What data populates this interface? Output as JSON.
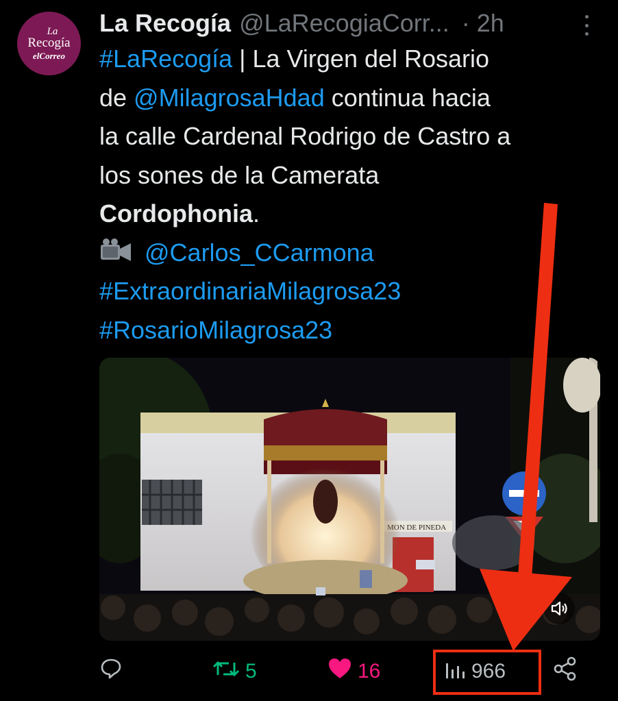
{
  "tweet": {
    "author_name": "La Recogía",
    "handle": "@LaRecogiaCorr...",
    "separator": "·",
    "time": "2h",
    "avatar": {
      "line1": "La",
      "line2": "Recogía",
      "line3": "elCorreo",
      "bg": "#7d1a55"
    },
    "text": {
      "l1_tag": "#LaRecogía",
      "l1_rest": " | La Virgen del Rosario",
      "l2_pre": "de ",
      "l2_mention": "@MilagrosaHdad",
      "l2_rest": " continua hacia",
      "l3": "la calle Cardenal Rodrigo de Castro a",
      "l4": "los sones de la Camerata",
      "l5_bold": "Cordophonia",
      "l5_rest": ".",
      "l6_mention": "@Carlos_CCarmona",
      "l7_tag": "#ExtraordinariaMilagrosa23",
      "l8_tag": "#RosarioMilagrosa23"
    },
    "media": {
      "sign_text": "MON DE PINEDA"
    },
    "actions": {
      "reply_count": "",
      "retweet_count": "5",
      "like_count": "16",
      "view_count": "966"
    }
  },
  "colors": {
    "background": "#000000",
    "text": "#e7e9ea",
    "secondary": "#71767b",
    "link": "#1d9bf0",
    "retweet": "#00ba7c",
    "like": "#f91880",
    "annotation": "#ee2e12"
  },
  "icons": [
    "more-icon",
    "video-camera-icon",
    "volume-icon",
    "reply-icon",
    "retweet-icon",
    "heart-icon",
    "views-icon",
    "share-icon"
  ]
}
